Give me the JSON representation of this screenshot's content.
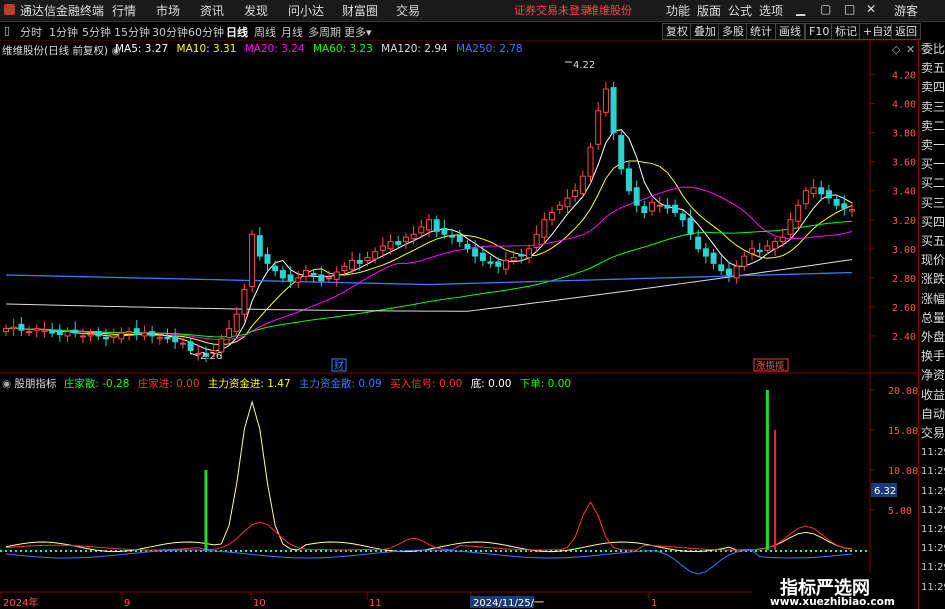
{
  "menubar": {
    "app_title": "通达信金融终端",
    "items": [
      "行情",
      "市场",
      "资讯",
      "发现",
      "问小达",
      "财富圈",
      "交易"
    ],
    "notice": "证券交易未登录",
    "stock": "维维股份",
    "right_items": [
      "功能",
      "版面",
      "公式",
      "选项"
    ],
    "guest": "游客"
  },
  "tabbar": {
    "periods": [
      "分时",
      "1分钟",
      "5分钟",
      "15分钟",
      "30分钟",
      "60分钟",
      "日线",
      "周线",
      "月线",
      "多周期",
      "更多"
    ],
    "active": "日线",
    "buttons": [
      "复权",
      "叠加",
      "多股",
      "统计",
      "画线",
      "F10",
      "标记",
      "+自选",
      "返回"
    ]
  },
  "main_legend": {
    "title": "维维股份(日线 前复权)",
    "ma": [
      {
        "label": "MA5: 3.27",
        "color": "#ffffff"
      },
      {
        "label": "MA10: 3.31",
        "color": "#ffff00"
      },
      {
        "label": "MA20: 3.24",
        "color": "#ff00ff"
      },
      {
        "label": "MA60: 3.23",
        "color": "#00ff00"
      },
      {
        "label": "MA120: 2.94",
        "color": "#dddddd"
      },
      {
        "label": "MA250: 2.78",
        "color": "#3c78ff"
      }
    ]
  },
  "annotations": {
    "high": "4.22",
    "low": "2.26",
    "cai": "财",
    "zhang": "涨揽揽"
  },
  "sub_legend": {
    "name": "股朋指标",
    "items": [
      {
        "label": "庄家散: -0.28",
        "color": "#00ff00"
      },
      {
        "label": "庄家进: 0.00",
        "color": "#ff3333"
      },
      {
        "label": "主力资金进: 1.47",
        "color": "#ffff00"
      },
      {
        "label": "主力资金散: 0.09",
        "color": "#3c78ff"
      },
      {
        "label": "买入信号: 0.00",
        "color": "#ff3333"
      },
      {
        "label": "底: 0.00",
        "color": "#ffffff"
      },
      {
        "label": "下单: 0.00",
        "color": "#00ff00"
      }
    ]
  },
  "right_panel": {
    "items": [
      "委比",
      "卖五",
      "卖四",
      "卖三",
      "卖二",
      "卖一",
      "买一",
      "买二",
      "买三",
      "买四",
      "买五",
      "现价",
      "涨跌",
      "涨幅",
      "总量",
      "外盘",
      "换手",
      "净资",
      "收益",
      "自动",
      "交易",
      "11:29",
      "11:29",
      "11:29",
      "11:29",
      "11:29",
      "11:29",
      "11:29",
      "11:29"
    ]
  },
  "price_axis": [
    "4.20",
    "4.00",
    "3.80",
    "3.60",
    "3.40",
    "3.20",
    "3.00",
    "2.80",
    "2.60",
    "2.40"
  ],
  "sub_axis": [
    "20.00",
    "15.00",
    "10.00",
    "5.00"
  ],
  "sub_current": "6.32",
  "date_axis": [
    "2024年",
    "9",
    "10",
    "11",
    "2024/11/25/一",
    "1"
  ],
  "watermark": {
    "cn": "指标严选网",
    "url": "www.xuezhibiao.com"
  },
  "chart_data": {
    "type": "candlestick",
    "ylim": [
      2.2,
      4.3
    ],
    "closes": [
      2.45,
      2.46,
      2.44,
      2.43,
      2.45,
      2.44,
      2.42,
      2.41,
      2.43,
      2.42,
      2.4,
      2.41,
      2.4,
      2.38,
      2.4,
      2.42,
      2.43,
      2.41,
      2.42,
      2.4,
      2.39,
      2.38,
      2.36,
      2.35,
      2.3,
      2.28,
      2.26,
      2.3,
      2.38,
      2.45,
      2.55,
      2.72,
      3.1,
      2.95,
      2.9,
      2.85,
      2.8,
      2.78,
      2.8,
      2.85,
      2.82,
      2.78,
      2.8,
      2.84,
      2.88,
      2.92,
      2.9,
      2.94,
      2.98,
      3.02,
      3.05,
      3.03,
      3.08,
      3.1,
      3.15,
      3.2,
      3.12,
      3.1,
      3.08,
      3.05,
      3.0,
      2.95,
      2.92,
      2.9,
      2.88,
      2.92,
      2.94,
      2.95,
      3.0,
      3.1,
      3.2,
      3.25,
      3.3,
      3.35,
      3.4,
      3.5,
      3.7,
      3.95,
      4.1,
      3.8,
      3.55,
      3.4,
      3.3,
      3.25,
      3.32,
      3.3,
      3.28,
      3.25,
      3.2,
      3.1,
      3.0,
      2.95,
      2.9,
      2.85,
      2.82,
      2.88,
      2.95,
      3.0,
      2.98,
      3.02,
      3.05,
      3.08,
      3.2,
      3.3,
      3.4,
      3.42,
      3.38,
      3.35,
      3.3,
      3.28,
      3.27
    ],
    "sub_ylim": [
      0,
      20
    ],
    "green_bars": [
      {
        "x": 26,
        "value": 10
      },
      {
        "x": 99,
        "value": 20
      }
    ],
    "red_bars": [
      {
        "x": 100,
        "value": 15
      }
    ]
  }
}
